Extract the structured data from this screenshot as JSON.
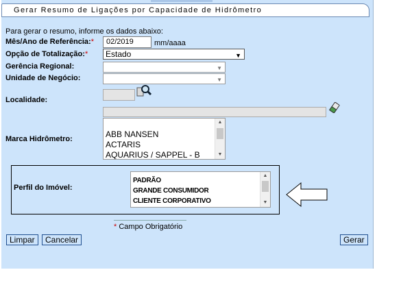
{
  "title": "Gerar Resumo de Ligações por Capacidade de Hidrômetro",
  "instructions": "Para gerar o resumo, informe os dados abaixo:",
  "required_marker": "*",
  "fields": {
    "mes_ano": {
      "label": "Mês/Ano de Referência:",
      "value": "02/2019",
      "hint": "mm/aaaa"
    },
    "totalizacao": {
      "label": "Opção de Totalização:",
      "value": "Estado"
    },
    "gerencia": {
      "label": "Gerência Regional:",
      "value": ""
    },
    "unidade": {
      "label": "Unidade de Negócio:",
      "value": ""
    },
    "localidade": {
      "label": "Localidade:",
      "code": "",
      "name": ""
    },
    "marca": {
      "label": "Marca Hidrômetro:",
      "options": [
        "ABB NANSEN",
        "ACTARIS",
        "AQUARIUS / SAPPEL - B"
      ]
    },
    "perfil": {
      "label": "Perfil do Imóvel:",
      "options": [
        "PADRÃO",
        "GRANDE CONSUMIDOR",
        "CLIENTE CORPORATIVO"
      ]
    }
  },
  "required_note": "Campo Obrigatório",
  "buttons": {
    "limpar": "Limpar",
    "cancelar": "Cancelar",
    "gerar": "Gerar"
  },
  "icons": {
    "search": "magnifier-icon",
    "eraser": "eraser-icon",
    "arrow": "left-arrow-annotation-icon"
  }
}
